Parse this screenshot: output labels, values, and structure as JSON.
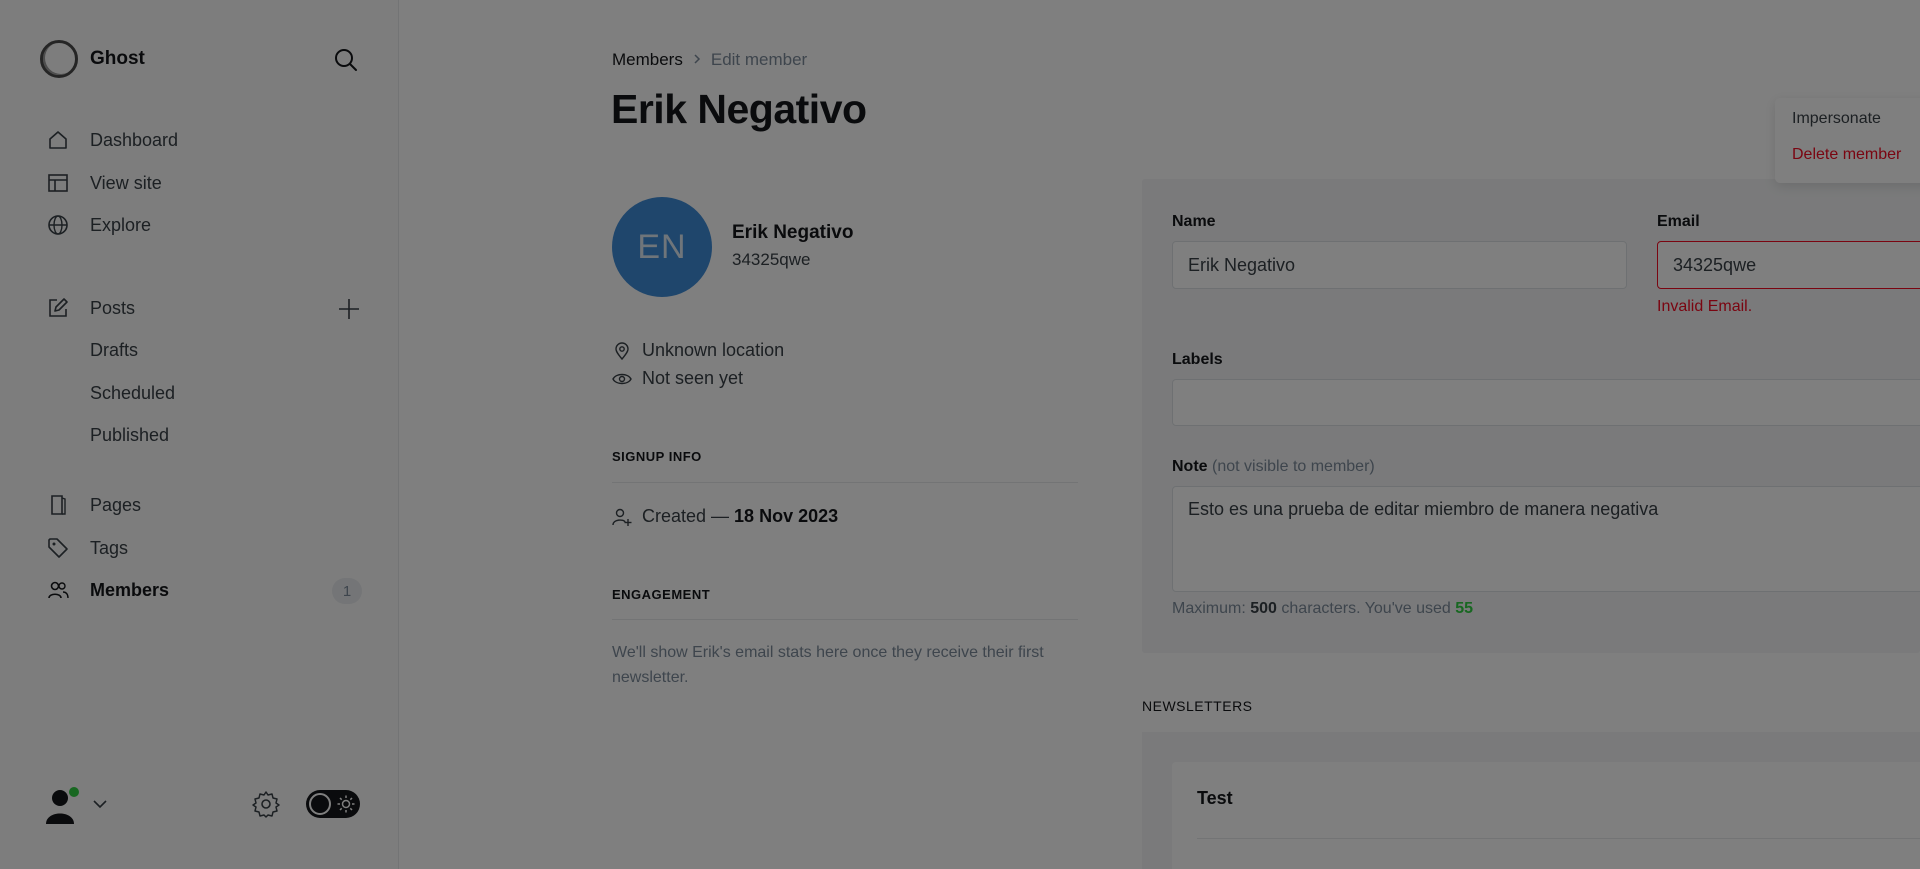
{
  "app": {
    "name": "Ghost"
  },
  "sidebar": {
    "nav": [
      {
        "label": "Dashboard",
        "icon": "home-icon"
      },
      {
        "label": "View site",
        "icon": "layout-icon"
      },
      {
        "label": "Explore",
        "icon": "globe-icon"
      }
    ],
    "posts": {
      "label": "Posts",
      "icon": "edit-icon"
    },
    "post_subs": [
      "Drafts",
      "Scheduled",
      "Published"
    ],
    "pages": {
      "label": "Pages",
      "icon": "page-icon"
    },
    "tags": {
      "label": "Tags",
      "icon": "tag-icon"
    },
    "members": {
      "label": "Members",
      "icon": "members-icon",
      "count": "1"
    }
  },
  "breadcrumb": {
    "parent": "Members",
    "current": "Edit member"
  },
  "page_title": "Erik Negativo",
  "member": {
    "initials": "EN",
    "name": "Erik Negativo",
    "email": "34325qwe",
    "location": "Unknown location",
    "last_seen": "Not seen yet",
    "avatar_color": "#3e8cd8"
  },
  "signup": {
    "label": "Signup info",
    "created_prefix": "Created —",
    "created_date": "18 Nov 2023"
  },
  "engagement": {
    "label": "Engagement",
    "text": "We'll show Erik's email stats here once they receive their first newsletter."
  },
  "form": {
    "name_label": "Name",
    "name_value": "Erik Negativo",
    "email_label": "Email",
    "email_value": "34325qwe",
    "email_error": "Invalid Email.",
    "labels_label": "Labels",
    "note_label": "Note",
    "note_sublabel": "(not visible to member)",
    "note_value": "Esto es una prueba de editar miembro de manera negativa",
    "hint_prefix": "Maximum:",
    "hint_max": "500",
    "hint_mid": "characters. You've used",
    "hint_used": "55"
  },
  "newsletters": {
    "label": "Newsletters",
    "items": [
      {
        "name": "Test"
      }
    ]
  },
  "dropdown": {
    "impersonate": "Impersonate",
    "delete": "Delete member"
  },
  "colors": {
    "accent": "#30cf43",
    "danger": "#f50b23",
    "online": "#30cf43"
  }
}
